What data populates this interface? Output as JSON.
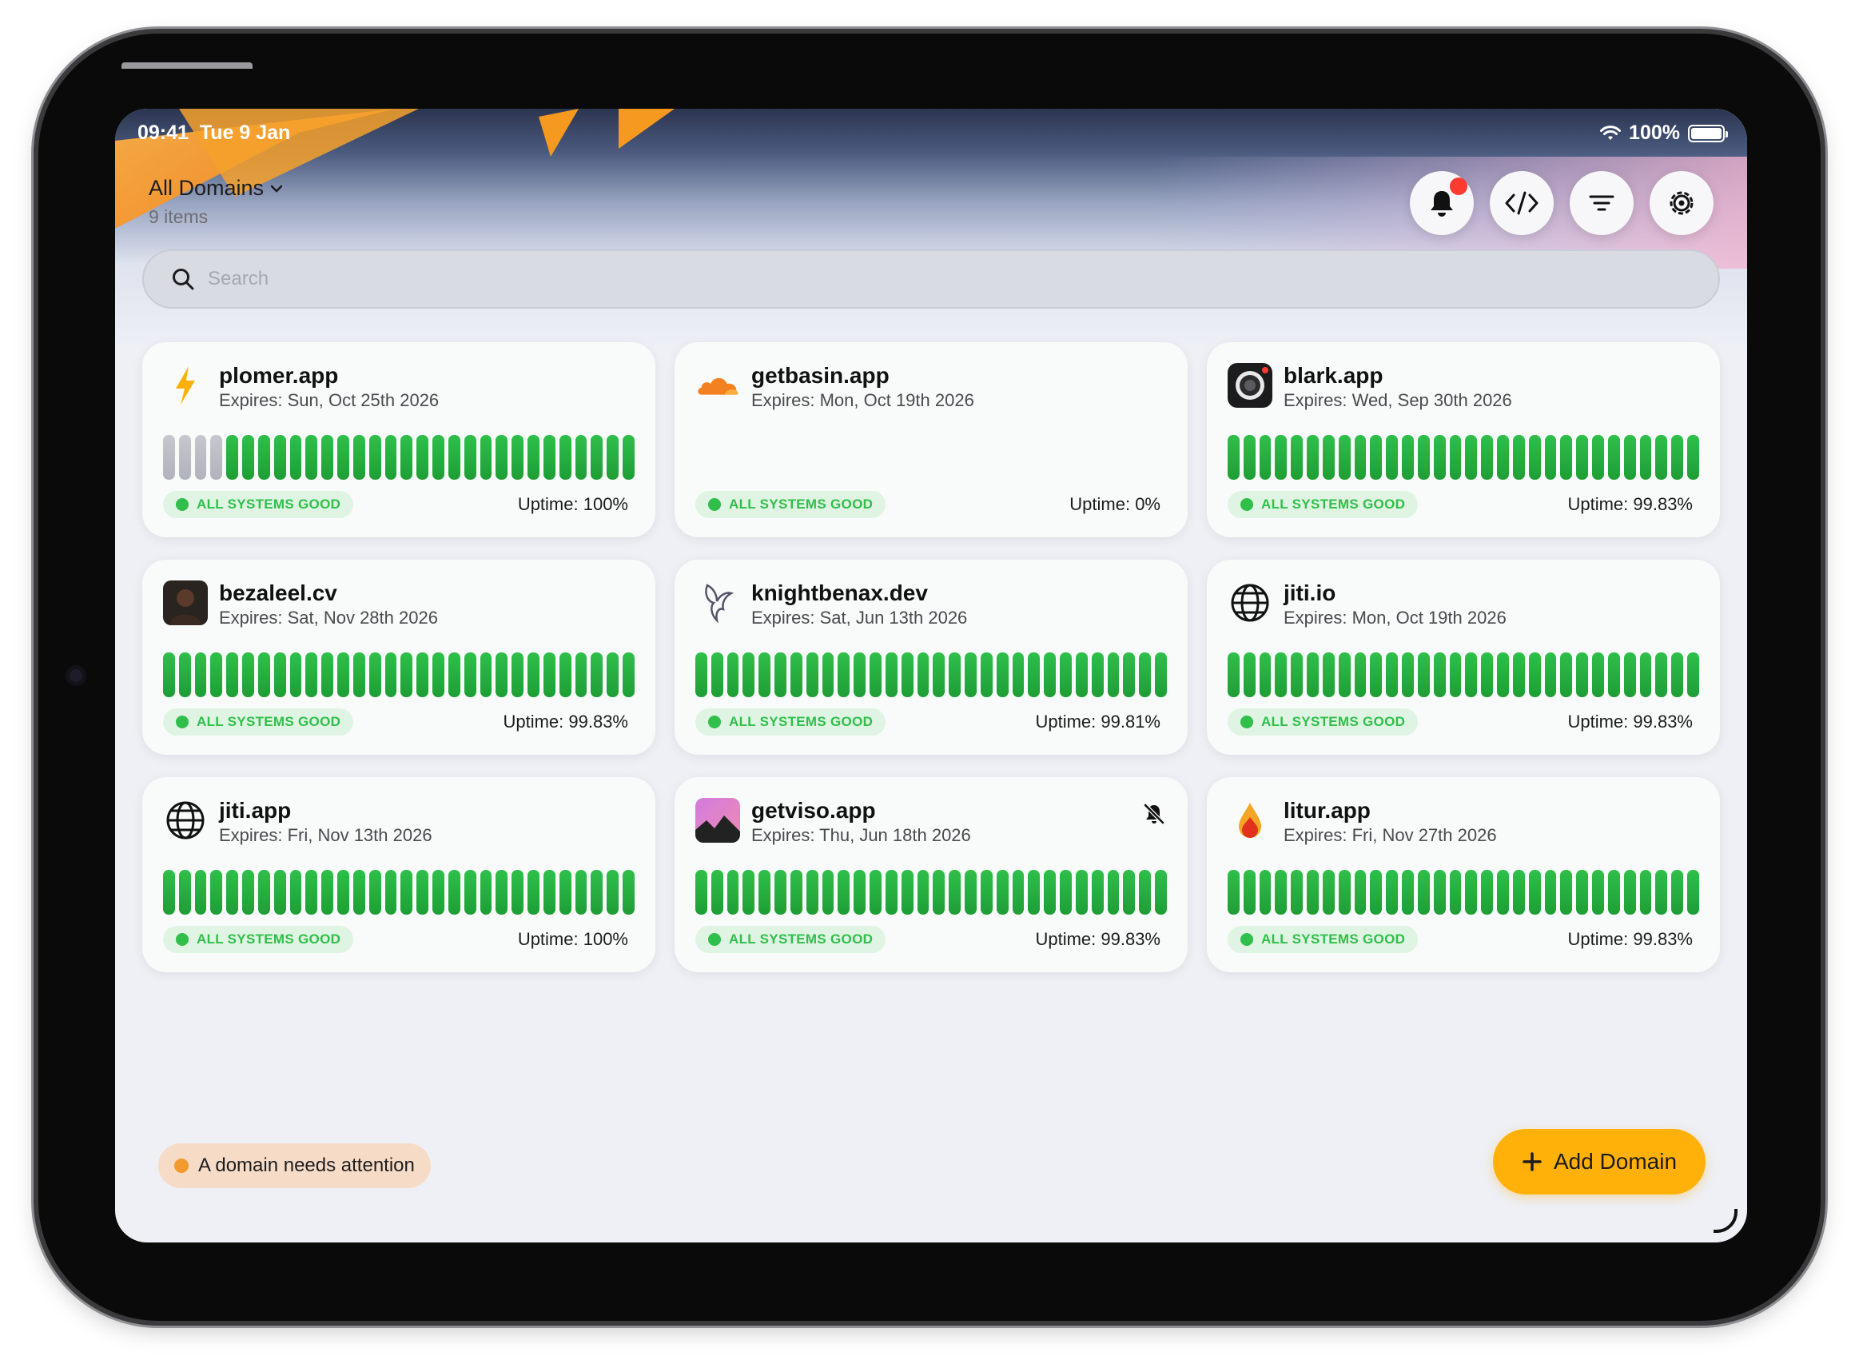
{
  "status_bar": {
    "time": "09:41",
    "date": "Tue 9 Jan",
    "battery": "100%"
  },
  "header": {
    "title": "All Domains",
    "subtitle": "9 items"
  },
  "toolbar": {
    "icons": [
      "bell-icon",
      "code-icon",
      "filter-icon",
      "settings-icon"
    ],
    "has_notification": true
  },
  "search": {
    "placeholder": "Search",
    "value": ""
  },
  "colors": {
    "accent": "#ffb10a",
    "good": "#2fbf4a",
    "attention": "#f29a2e",
    "notification": "#ff3b30"
  },
  "domains": [
    {
      "name": "plomer.app",
      "expires": "Expires: Sun, Oct 25th 2026",
      "status": "ALL SYSTEMS GOOD",
      "uptime": "Uptime: 100%",
      "logo": "lightning-icon",
      "grey_bars": 4,
      "green_bars": 26,
      "show_bars": true,
      "muted": false
    },
    {
      "name": "getbasin.app",
      "expires": "Expires: Mon, Oct 19th 2026",
      "status": "ALL SYSTEMS GOOD",
      "uptime": "Uptime: 0%",
      "logo": "cloud-icon",
      "grey_bars": 0,
      "green_bars": 0,
      "show_bars": false,
      "muted": false
    },
    {
      "name": "blark.app",
      "expires": "Expires: Wed, Sep 30th 2026",
      "status": "ALL SYSTEMS GOOD",
      "uptime": "Uptime: 99.83%",
      "logo": "lens-icon",
      "grey_bars": 0,
      "green_bars": 30,
      "show_bars": true,
      "muted": false
    },
    {
      "name": "bezaleel.cv",
      "expires": "Expires: Sat, Nov 28th 2026",
      "status": "ALL SYSTEMS GOOD",
      "uptime": "Uptime: 99.83%",
      "logo": "avatar-icon",
      "grey_bars": 0,
      "green_bars": 30,
      "show_bars": true,
      "muted": false
    },
    {
      "name": "knightbenax.dev",
      "expires": "Expires: Sat, Jun 13th 2026",
      "status": "ALL SYSTEMS GOOD",
      "uptime": "Uptime: 99.81%",
      "logo": "bird-icon",
      "grey_bars": 0,
      "green_bars": 30,
      "show_bars": true,
      "muted": false
    },
    {
      "name": "jiti.io",
      "expires": "Expires: Mon, Oct 19th 2026",
      "status": "ALL SYSTEMS GOOD",
      "uptime": "Uptime: 99.83%",
      "logo": "globe-icon",
      "grey_bars": 0,
      "green_bars": 30,
      "show_bars": true,
      "muted": false
    },
    {
      "name": "jiti.app",
      "expires": "Expires: Fri, Nov 13th 2026",
      "status": "ALL SYSTEMS GOOD",
      "uptime": "Uptime: 100%",
      "logo": "globe-icon",
      "grey_bars": 0,
      "green_bars": 30,
      "show_bars": true,
      "muted": false
    },
    {
      "name": "getviso.app",
      "expires": "Expires: Thu, Jun 18th 2026",
      "status": "ALL SYSTEMS GOOD",
      "uptime": "Uptime: 99.83%",
      "logo": "mountain-icon",
      "grey_bars": 0,
      "green_bars": 30,
      "show_bars": true,
      "muted": true
    },
    {
      "name": "litur.app",
      "expires": "Expires: Fri, Nov 27th 2026",
      "status": "ALL SYSTEMS GOOD",
      "uptime": "Uptime: 99.83%",
      "logo": "drop-icon",
      "grey_bars": 0,
      "green_bars": 30,
      "show_bars": true,
      "muted": false
    }
  ],
  "attention": {
    "label": "A domain needs attention"
  },
  "add_button": {
    "label": "Add Domain"
  }
}
